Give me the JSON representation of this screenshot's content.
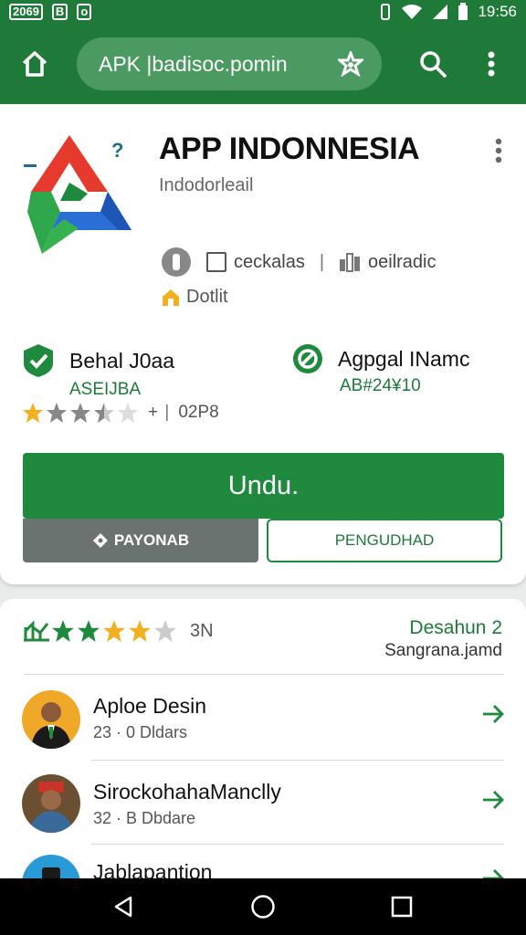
{
  "status_bar": {
    "left_items": [
      "2069",
      "B",
      "o"
    ],
    "time": "19:56"
  },
  "toolbar": {
    "url": "APK |badisoc.pomin",
    "icons": [
      "home-icon",
      "star-badge-icon",
      "search-icon",
      "more-vert-icon"
    ]
  },
  "app": {
    "title": "APP INDONNESIA",
    "developer": "Indodorleail",
    "meta": {
      "item1_label": "ceckalas",
      "item2_label": "oeilradic"
    },
    "tag_label": "Dotlit",
    "stats": {
      "left": {
        "title": "Behal J0aa",
        "sub": "ASEIJBA"
      },
      "right": {
        "title": "Agpgal INamc",
        "sub": "AB#24¥10"
      }
    },
    "rating": {
      "stars": 2.5,
      "count_label": "02P8",
      "extra": "+"
    },
    "buttons": {
      "install": "Undu.",
      "secondary": "PAYONAB",
      "outline": "PENGUDHAD"
    }
  },
  "reviews": {
    "rating_stars": 4,
    "count_label": "3N",
    "link": "Desahun 2",
    "sub": "Sangrana.jamd",
    "items": [
      {
        "title": "Aploe Desin",
        "sub": "23 · 0 Dldars"
      },
      {
        "title": "SirockohahaManclly",
        "sub": "32 · B Dbdare"
      },
      {
        "title": "Jablapantion",
        "sub": ""
      }
    ]
  },
  "colors": {
    "brand": "#1f7a3a",
    "button": "#1f8a3e",
    "star": "#f2b01e"
  },
  "nav": {
    "icons": [
      "back-icon",
      "home-circle-icon",
      "recents-icon"
    ]
  }
}
